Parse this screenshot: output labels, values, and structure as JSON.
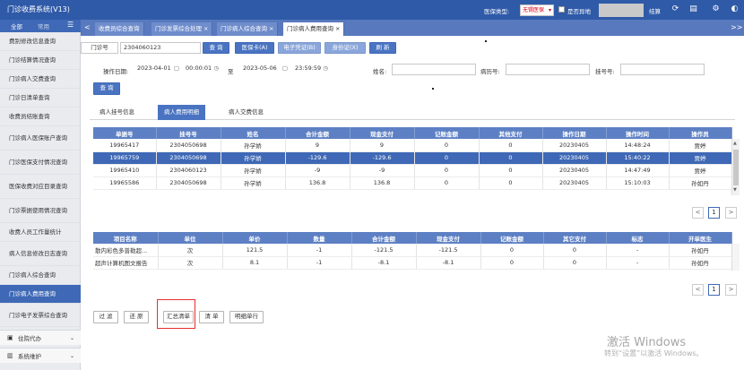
{
  "app": {
    "title": "门诊收费系统(V13)"
  },
  "topbar": {
    "insurance_type_label": "医保类型:",
    "insurance_type_value": "无锡医保",
    "offsite_label": "是否异地",
    "user_label": "结算",
    "icons": [
      "refresh-icon",
      "document-icon",
      "settings-icon",
      "user-icon"
    ]
  },
  "sidebar": {
    "tabs": [
      "全部",
      "常用"
    ],
    "items": [
      {
        "label": "费别修改信息查询"
      },
      {
        "label": "门诊结算情况查询"
      },
      {
        "label": "门诊病人交费查询"
      },
      {
        "label": "门诊日清单查询"
      },
      {
        "label": "收费员结账查询"
      },
      {
        "label": "门诊病人医保账户查询"
      },
      {
        "label": "门诊医保支付情况查询"
      },
      {
        "label": "医保收费对应目录查询"
      },
      {
        "label": "门诊票据使用情况查询"
      },
      {
        "label": "收费人员工作量统计"
      },
      {
        "label": "病人信息修改日志查询"
      },
      {
        "label": "门诊病人综合查询"
      },
      {
        "label": "门诊病人费用查询",
        "active": true
      },
      {
        "label": "门诊电子发票综合查询"
      }
    ],
    "bottom": [
      {
        "label": "住院代办",
        "icon": "building-icon"
      },
      {
        "label": "系统维护",
        "icon": "tools-icon"
      }
    ]
  },
  "tabs": {
    "nav_left": "<",
    "nav_right": ">>",
    "items": [
      {
        "label": "收费员综合查询",
        "closable": false
      },
      {
        "label": "门诊发票综合处理",
        "closable": true
      },
      {
        "label": "门诊病人综合查询",
        "closable": true
      },
      {
        "label": "门诊病人费用查询",
        "closable": true,
        "active": true
      }
    ]
  },
  "search": {
    "clinic_no_label": "门诊号",
    "clinic_no_value": "2304060123",
    "buttons": [
      "查 询",
      "医保卡(A)",
      "电子凭证(B)",
      "身份证(X)",
      "刷 新"
    ],
    "operation_date_label": "操作日期:",
    "date_from": "2023-04-01",
    "time_from": "00:00:01",
    "to_label": "至",
    "date_to": "2023-05-06",
    "time_to": "23:59:59",
    "name_label": "姓名:",
    "record_no_label": "病历号:",
    "reg_no_label": "挂号号:",
    "query_button": "查 询"
  },
  "subtabs": [
    {
      "label": "病人挂号信息"
    },
    {
      "label": "病人费用明细",
      "active": true
    },
    {
      "label": "病人交费信息"
    }
  ],
  "table1": {
    "columns": [
      "单据号",
      "挂号号",
      "姓名",
      "合计金额",
      "现金支付",
      "记账金额",
      "其他支付",
      "操作日期",
      "操作时间",
      "操作员"
    ],
    "rows": [
      [
        "19965417",
        "2304050698",
        "孙学娇",
        "9",
        "9",
        "0",
        "0",
        "20230405",
        "14:48:24",
        "贾婷"
      ],
      [
        "19965759",
        "2304050698",
        "孙学娇",
        "-129.6",
        "-129.6",
        "0",
        "0",
        "20230405",
        "15:40:22",
        "贾婷"
      ],
      [
        "19965410",
        "2304060123",
        "孙学娇",
        "-9",
        "-9",
        "0",
        "0",
        "20230405",
        "14:47:49",
        "贾婷"
      ],
      [
        "19965586",
        "2304050698",
        "孙学娇",
        "136.8",
        "136.8",
        "0",
        "0",
        "20230405",
        "15:10:03",
        "孙如丹"
      ]
    ],
    "selected_row": 1
  },
  "pager1": {
    "prev": "<",
    "page": "1",
    "next": ">"
  },
  "table2": {
    "columns": [
      "项目名称",
      "单位",
      "单价",
      "数量",
      "合计金额",
      "现金支付",
      "记账金额",
      "其它支付",
      "标志",
      "开单医生"
    ],
    "rows": [
      [
        "散内彩色多普勒超...",
        "次",
        "121.5",
        "-1",
        "-121.5",
        "-121.5",
        "0",
        "0",
        "-",
        "孙如丹"
      ],
      [
        "超声计算机图文报告",
        "次",
        "8.1",
        "-1",
        "-8.1",
        "-8.1",
        "0",
        "0",
        "-",
        "孙如丹"
      ]
    ]
  },
  "pager2": {
    "prev": "<",
    "page": "1",
    "next": ">"
  },
  "bottom_buttons": [
    "过 滤",
    "还 原",
    "汇总清单",
    "清 单",
    "明细单行"
  ],
  "watermark": {
    "line1": "激活 Windows",
    "line2": "转到“设置”以激活 Windows。"
  }
}
